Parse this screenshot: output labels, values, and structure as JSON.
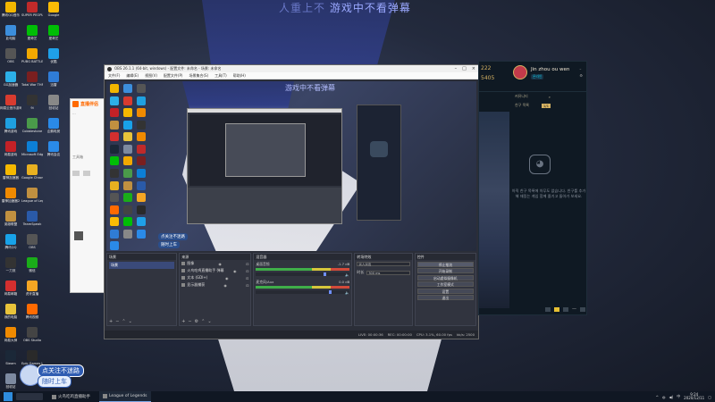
{
  "overlay": {
    "text_faded": "人重上不",
    "text_main": "游戏中不看弹幕"
  },
  "desktop_icons_col1": [
    {
      "label": "腾讯QQ音乐",
      "color": "#f2b600"
    },
    {
      "label": "此电脑",
      "color": "#3c8edc"
    },
    {
      "label": "OBS",
      "color": "#555555"
    },
    {
      "label": "GG加速器",
      "color": "#2cb0e8"
    },
    {
      "label": "网易云音乐游戏",
      "color": "#d83b2f"
    },
    {
      "label": "腾讯游戏",
      "color": "#1fa0e0"
    },
    {
      "label": "网易游戏",
      "color": "#c32127"
    },
    {
      "label": "雷神加速器",
      "color": "#f5b800"
    },
    {
      "label": "雷神加速器2",
      "color": "#f08a00"
    },
    {
      "label": "英雄联盟",
      "color": "#c09040"
    },
    {
      "label": "腾讯QQ",
      "color": "#18a2e8"
    },
    {
      "label": "一刀流",
      "color": "#333333"
    },
    {
      "label": "网易邮箱",
      "color": "#d32f2f"
    },
    {
      "label": "我的电脑",
      "color": "#e8c33a"
    },
    {
      "label": "网易大神",
      "color": "#f08a00"
    },
    {
      "label": "Steam",
      "color": "#1b2838"
    },
    {
      "label": "回收站",
      "color": "#7d8aa0"
    }
  ],
  "desktop_icons_col2": [
    {
      "label": "SUPER PEOPLE CBT",
      "color": "#c02a2a"
    },
    {
      "label": "爱奇艺",
      "color": "#00be06"
    },
    {
      "label": "PUBG BATTLEGR...",
      "color": "#f2a900"
    },
    {
      "label": "Total War THREE KI...",
      "color": "#7a1f1f"
    },
    {
      "label": "9i",
      "color": "#333333"
    },
    {
      "label": "Cobblestone",
      "color": "#4a9a4a"
    },
    {
      "label": "Microsoft Edge",
      "color": "#0c7fd6"
    },
    {
      "label": "Google Chrome",
      "color": "#e8b020"
    },
    {
      "label": "League of Legends",
      "color": "#c09040"
    },
    {
      "label": "TeamSpeak",
      "color": "#2a5aa8"
    },
    {
      "label": "OBS",
      "color": "#555555"
    },
    {
      "label": "微信",
      "color": "#1aad19"
    },
    {
      "label": "虎牙直播",
      "color": "#f5a623"
    },
    {
      "label": "腾讯视频",
      "color": "#ff6a00"
    },
    {
      "label": "OBS Studio",
      "color": "#444444"
    },
    {
      "label": "Epic Games Launcher",
      "color": "#2a2a2a"
    }
  ],
  "desktop_icons_col3": [
    {
      "label": "Google",
      "color": "#fbbc05"
    },
    {
      "label": "爱奇艺",
      "color": "#00be06"
    },
    {
      "label": "优酷",
      "color": "#1fa0e8"
    },
    {
      "label": "迅雷",
      "color": "#2f7cd6"
    },
    {
      "label": "回收站",
      "color": "#888888"
    },
    {
      "label": "企鹅电竞",
      "color": "#2a8ae8"
    },
    {
      "label": "腾讯会议",
      "color": "#2a8ae8"
    }
  ],
  "side_panel": {
    "brand": "直播伴侣",
    "hint": "...",
    "tool_label": "工具箱"
  },
  "obs": {
    "title": "OBS 26.1.1 (64-bit, windows) - 配置文件: 未命名 - 场景: 未命名",
    "menu": [
      "文件(F)",
      "编辑(E)",
      "视图(V)",
      "配置文件(P)",
      "场景集合(S)",
      "工具(T)",
      "帮助(H)"
    ],
    "preview_overlay": "游戏中不看弹幕",
    "preview_badge1": "点关注不迷路",
    "preview_badge2": "随时上车",
    "docks": {
      "scenes": "场景",
      "sources": "来源",
      "mixer": "混音器",
      "transitions": "转场特效",
      "controls": "控件"
    },
    "scene_item": "场景",
    "sources_list": [
      {
        "name": "图像"
      },
      {
        "name": "火鸟吃鸡直播助手 弹幕"
      },
      {
        "name": "文本 (GDI+)"
      },
      {
        "name": "显示器捕获"
      }
    ],
    "mixer": [
      {
        "name": "桌面音频",
        "db": "-1.7 dB"
      },
      {
        "name": "麦克风/Aux",
        "db": "0.0 dB"
      }
    ],
    "transition": {
      "label": "淡入淡出",
      "duration_label": "时长",
      "duration": "300 ms"
    },
    "controls": [
      "停止推流",
      "开始录制",
      "启动虚拟摄像机",
      "工作室模式",
      "设置",
      "退出"
    ],
    "status": {
      "live": "LIVE: 00:00:36",
      "rec": "REC: 00:00:00",
      "cpu": "CPU: 3.1%, 60.00 fps",
      "kbps": "kb/s: 2500"
    }
  },
  "friends": {
    "level": "222",
    "coins": "5405",
    "name": "Jin zhou ou wen",
    "status": "온라인",
    "section": "커뮤니티",
    "tab": "친구 목록",
    "badge": "1/1",
    "empty_text": "아직 친구 목록에 아무도 없습니다. 친구를 추가해 재밌는 게임 함께 즐기고 돌아가 보세요."
  },
  "stream_badge": {
    "line1": "点关注不迷路",
    "line2": "随时上车"
  },
  "taskbar": {
    "items": [
      {
        "label": "火鸟吃鸡直播助手"
      },
      {
        "label": "League of Legends"
      }
    ],
    "time": "9:24",
    "date": "2020/12/11",
    "lang": "中"
  }
}
